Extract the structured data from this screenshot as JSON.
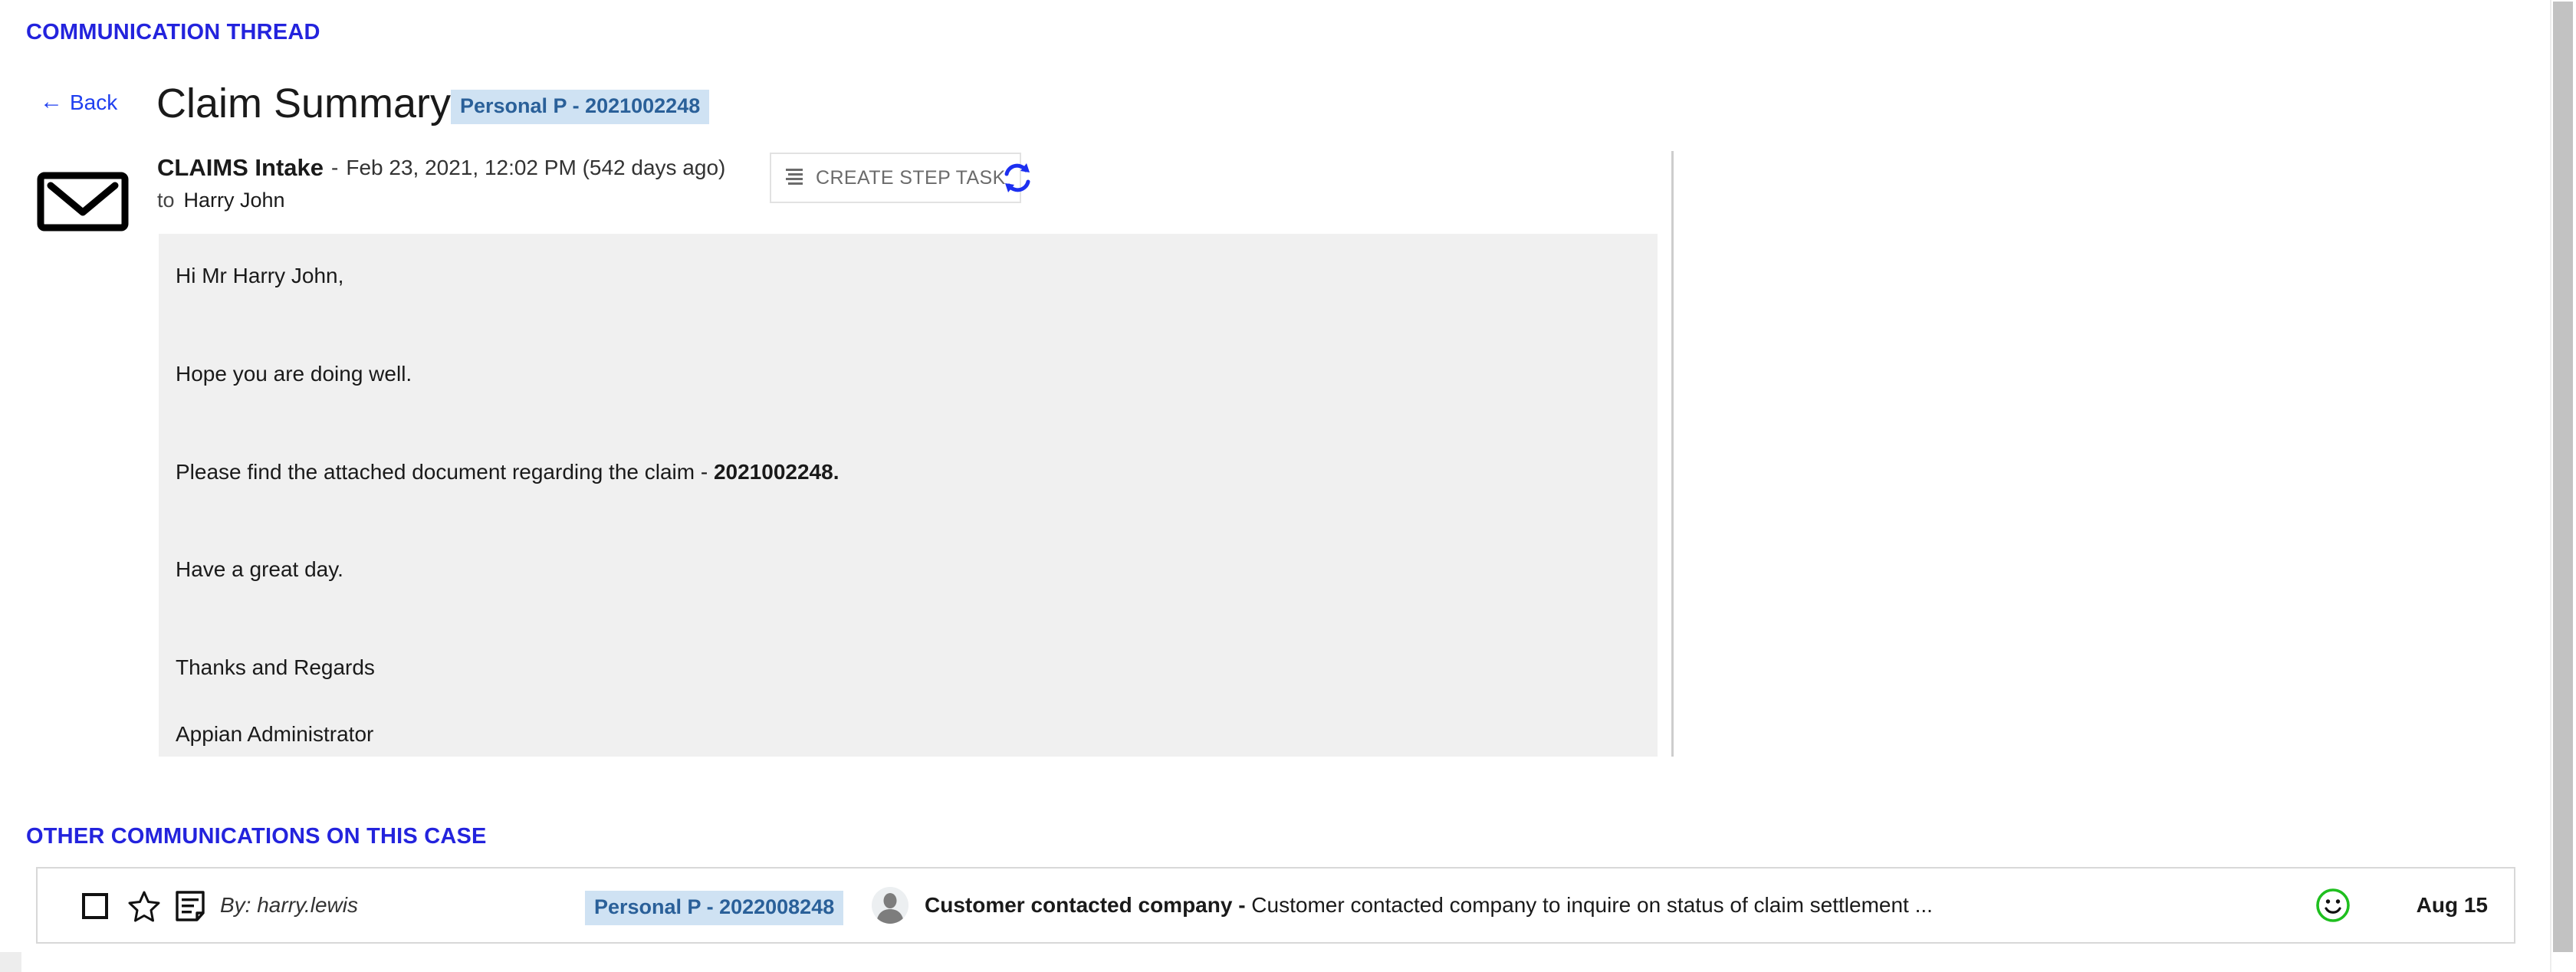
{
  "thread": {
    "heading": "COMMUNICATION THREAD",
    "back_label": "Back",
    "back_icon": "arrow-left-icon",
    "page_title": "Claim Summary",
    "case_badge": "Personal P - 2021002248"
  },
  "message": {
    "channel_icon": "envelope-icon",
    "sender": "CLAIMS Intake",
    "separator": "-",
    "timestamp": "Feb 23, 2021, 12:02 PM (542 days ago)",
    "to_label": "to",
    "to_recipient": "Harry John",
    "create_step_task": {
      "label": "CREATE STEP TASK",
      "icon": "list-lines-icon"
    },
    "refresh_icon": "refresh-icon",
    "body": {
      "greeting": "Hi Mr Harry John,",
      "line2": "Hope you are doing well.",
      "line3_prefix": "Please find the attached document regarding the claim - ",
      "line3_claim": "2021002248.",
      "line4": "Have a great day.",
      "signoff": "Thanks and Regards",
      "signature": "Appian Administrator"
    }
  },
  "other_communications": {
    "heading": "OTHER COMMUNICATIONS ON THIS CASE",
    "rows": [
      {
        "checkbox_icon": "checkbox-unchecked-icon",
        "star_icon": "star-outline-icon",
        "note_icon": "note-document-icon",
        "author": "By: harry.lewis",
        "badge": "Personal P - 2022008248",
        "avatar_icon": "user-avatar",
        "subject_bold": "Customer contacted company -",
        "subject_rest": " Customer contacted company to inquire on status of claim settlement ...",
        "sentiment_icon": "smiley-positive-icon",
        "date": "Aug 15"
      }
    ]
  },
  "colors": {
    "heading_blue": "#2323dd",
    "link_blue": "#1f3ff0",
    "badge_bg": "#cfe2f3",
    "badge_text": "#2a6099",
    "body_bg": "#f0f0f0",
    "sentiment_green": "#1fbf1f",
    "refresh_blue": "#1c2ff0",
    "divider_gray": "#cdcdcd"
  },
  "scrollbars": {
    "vertical_present": true,
    "horizontal_present": true
  }
}
